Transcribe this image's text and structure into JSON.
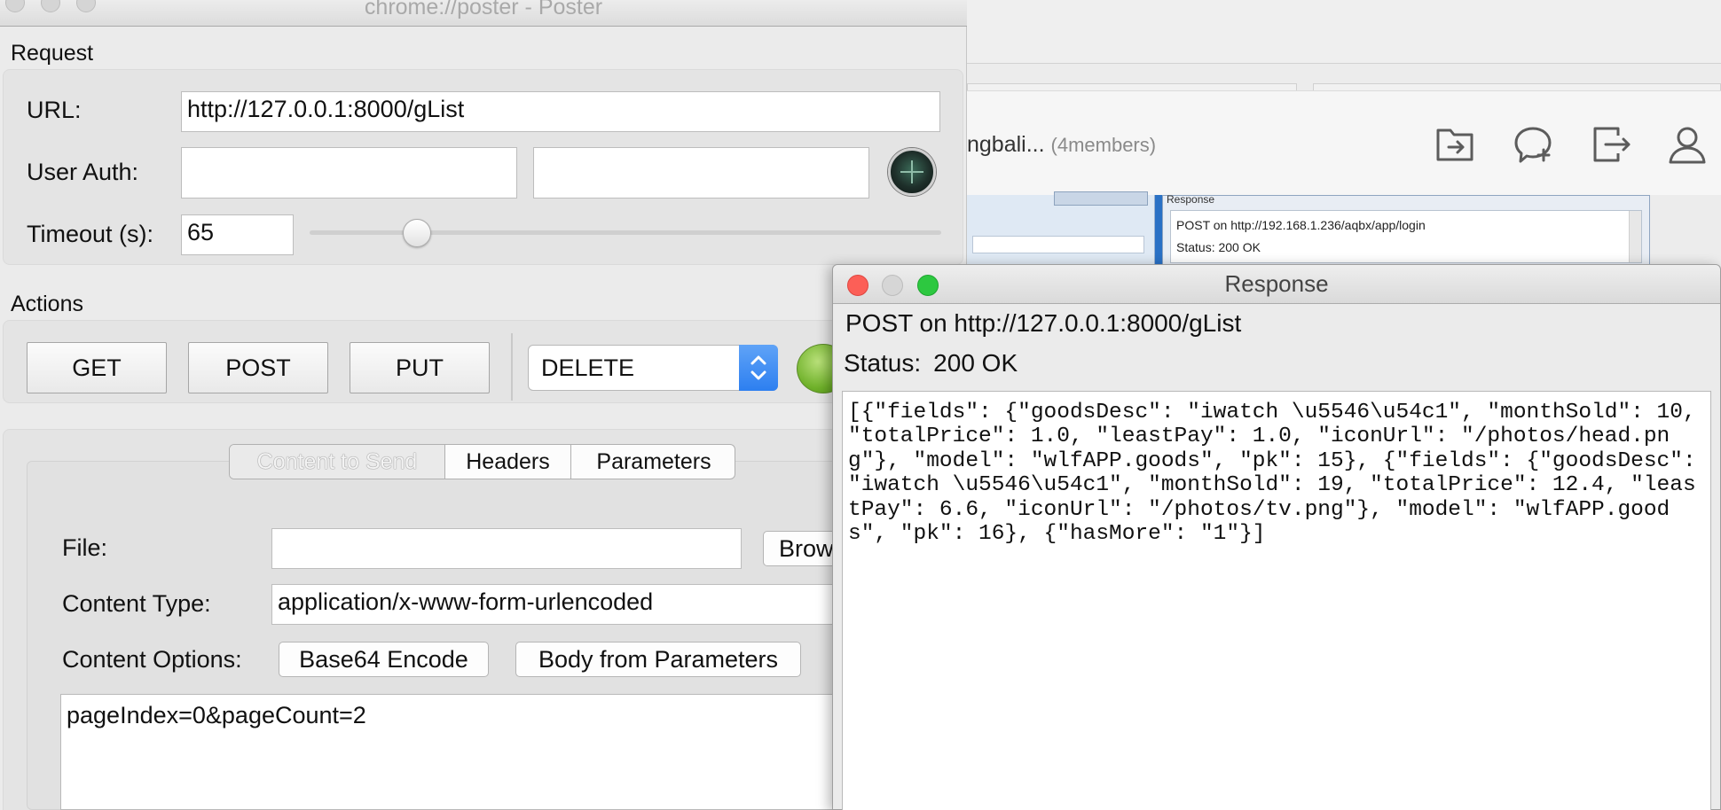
{
  "background_app": {
    "conversation_title": "ngbali...",
    "members": "(4members)",
    "icons": [
      "folder-transfer-icon",
      "chat-bubble-add-icon",
      "exit-group-icon",
      "user-profile-icon"
    ],
    "embedded_screenshot": {
      "panel_title": "Response",
      "line1": "POST on http://192.168.1.236/aqbx/app/login",
      "line2": "Status:  200 OK"
    }
  },
  "poster": {
    "window_title": "chrome://poster - Poster",
    "request": {
      "section_label": "Request",
      "url_label": "URL:",
      "url_value": "http://127.0.0.1:8000/gList",
      "user_auth_label": "User Auth:",
      "user_value": "",
      "password_value": "",
      "timeout_label": "Timeout (s):",
      "timeout_value": "65",
      "timeout_slider_level": 0.17
    },
    "actions": {
      "section_label": "Actions",
      "get_label": "GET",
      "post_label": "POST",
      "put_label": "PUT",
      "method_select_value": "DELETE"
    },
    "tabs": [
      "Content to Send",
      "Headers",
      "Parameters"
    ],
    "active_tab": "Content to Send",
    "content": {
      "file_label": "File:",
      "file_value": "",
      "browse_label": "Brow",
      "content_type_label": "Content Type:",
      "content_type_value": "application/x-www-form-urlencoded",
      "content_options_label": "Content Options:",
      "base64_label": "Base64 Encode",
      "body_from_params_label": "Body from Parameters",
      "body": "pageIndex=0&pageCount=2"
    }
  },
  "response": {
    "window_title": "Response",
    "request_line": "POST on http://127.0.0.1:8000/gList",
    "status_label": "Status:",
    "status_value": "200 OK",
    "body": "[{\"fields\": {\"goodsDesc\": \"iwatch \\u5546\\u54c1\", \"monthSold\": 10, \"totalPrice\": 1.0, \"leastPay\": 1.0, \"iconUrl\": \"/photos/head.png\"}, \"model\": \"wlfAPP.goods\", \"pk\": 15}, {\"fields\": {\"goodsDesc\": \"iwatch \\u5546\\u54c1\", \"monthSold\": 19, \"totalPrice\": 12.4, \"leastPay\": 6.6, \"iconUrl\": \"/photos/tv.png\"}, \"model\": \"wlfAPP.goods\", \"pk\": 16}, {\"hasMore\": \"1\"}]"
  },
  "colors": {
    "close_red": "#fc5f57",
    "zoom_green": "#2dc840",
    "select_blue": "#2d7ff0",
    "go_green": "#6fb12a"
  }
}
